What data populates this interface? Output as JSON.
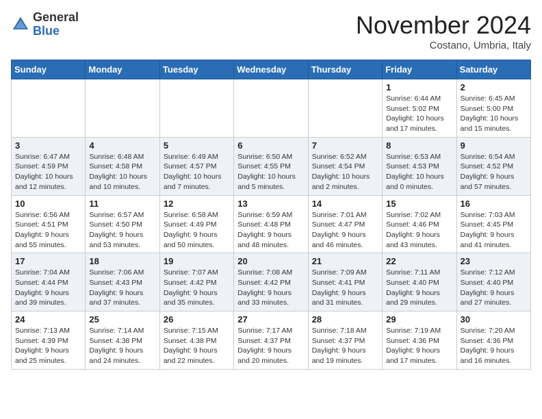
{
  "header": {
    "logo_general": "General",
    "logo_blue": "Blue",
    "month_title": "November 2024",
    "location": "Costano, Umbria, Italy"
  },
  "days_of_week": [
    "Sunday",
    "Monday",
    "Tuesday",
    "Wednesday",
    "Thursday",
    "Friday",
    "Saturday"
  ],
  "weeks": [
    {
      "row_alt": false,
      "days": [
        {
          "date": "",
          "info": ""
        },
        {
          "date": "",
          "info": ""
        },
        {
          "date": "",
          "info": ""
        },
        {
          "date": "",
          "info": ""
        },
        {
          "date": "",
          "info": ""
        },
        {
          "date": "1",
          "info": "Sunrise: 6:44 AM\nSunset: 5:02 PM\nDaylight: 10 hours\nand 17 minutes."
        },
        {
          "date": "2",
          "info": "Sunrise: 6:45 AM\nSunset: 5:00 PM\nDaylight: 10 hours\nand 15 minutes."
        }
      ]
    },
    {
      "row_alt": true,
      "days": [
        {
          "date": "3",
          "info": "Sunrise: 6:47 AM\nSunset: 4:59 PM\nDaylight: 10 hours\nand 12 minutes."
        },
        {
          "date": "4",
          "info": "Sunrise: 6:48 AM\nSunset: 4:58 PM\nDaylight: 10 hours\nand 10 minutes."
        },
        {
          "date": "5",
          "info": "Sunrise: 6:49 AM\nSunset: 4:57 PM\nDaylight: 10 hours\nand 7 minutes."
        },
        {
          "date": "6",
          "info": "Sunrise: 6:50 AM\nSunset: 4:55 PM\nDaylight: 10 hours\nand 5 minutes."
        },
        {
          "date": "7",
          "info": "Sunrise: 6:52 AM\nSunset: 4:54 PM\nDaylight: 10 hours\nand 2 minutes."
        },
        {
          "date": "8",
          "info": "Sunrise: 6:53 AM\nSunset: 4:53 PM\nDaylight: 10 hours\nand 0 minutes."
        },
        {
          "date": "9",
          "info": "Sunrise: 6:54 AM\nSunset: 4:52 PM\nDaylight: 9 hours\nand 57 minutes."
        }
      ]
    },
    {
      "row_alt": false,
      "days": [
        {
          "date": "10",
          "info": "Sunrise: 6:56 AM\nSunset: 4:51 PM\nDaylight: 9 hours\nand 55 minutes."
        },
        {
          "date": "11",
          "info": "Sunrise: 6:57 AM\nSunset: 4:50 PM\nDaylight: 9 hours\nand 53 minutes."
        },
        {
          "date": "12",
          "info": "Sunrise: 6:58 AM\nSunset: 4:49 PM\nDaylight: 9 hours\nand 50 minutes."
        },
        {
          "date": "13",
          "info": "Sunrise: 6:59 AM\nSunset: 4:48 PM\nDaylight: 9 hours\nand 48 minutes."
        },
        {
          "date": "14",
          "info": "Sunrise: 7:01 AM\nSunset: 4:47 PM\nDaylight: 9 hours\nand 46 minutes."
        },
        {
          "date": "15",
          "info": "Sunrise: 7:02 AM\nSunset: 4:46 PM\nDaylight: 9 hours\nand 43 minutes."
        },
        {
          "date": "16",
          "info": "Sunrise: 7:03 AM\nSunset: 4:45 PM\nDaylight: 9 hours\nand 41 minutes."
        }
      ]
    },
    {
      "row_alt": true,
      "days": [
        {
          "date": "17",
          "info": "Sunrise: 7:04 AM\nSunset: 4:44 PM\nDaylight: 9 hours\nand 39 minutes."
        },
        {
          "date": "18",
          "info": "Sunrise: 7:06 AM\nSunset: 4:43 PM\nDaylight: 9 hours\nand 37 minutes."
        },
        {
          "date": "19",
          "info": "Sunrise: 7:07 AM\nSunset: 4:42 PM\nDaylight: 9 hours\nand 35 minutes."
        },
        {
          "date": "20",
          "info": "Sunrise: 7:08 AM\nSunset: 4:42 PM\nDaylight: 9 hours\nand 33 minutes."
        },
        {
          "date": "21",
          "info": "Sunrise: 7:09 AM\nSunset: 4:41 PM\nDaylight: 9 hours\nand 31 minutes."
        },
        {
          "date": "22",
          "info": "Sunrise: 7:11 AM\nSunset: 4:40 PM\nDaylight: 9 hours\nand 29 minutes."
        },
        {
          "date": "23",
          "info": "Sunrise: 7:12 AM\nSunset: 4:40 PM\nDaylight: 9 hours\nand 27 minutes."
        }
      ]
    },
    {
      "row_alt": false,
      "days": [
        {
          "date": "24",
          "info": "Sunrise: 7:13 AM\nSunset: 4:39 PM\nDaylight: 9 hours\nand 25 minutes."
        },
        {
          "date": "25",
          "info": "Sunrise: 7:14 AM\nSunset: 4:38 PM\nDaylight: 9 hours\nand 24 minutes."
        },
        {
          "date": "26",
          "info": "Sunrise: 7:15 AM\nSunset: 4:38 PM\nDaylight: 9 hours\nand 22 minutes."
        },
        {
          "date": "27",
          "info": "Sunrise: 7:17 AM\nSunset: 4:37 PM\nDaylight: 9 hours\nand 20 minutes."
        },
        {
          "date": "28",
          "info": "Sunrise: 7:18 AM\nSunset: 4:37 PM\nDaylight: 9 hours\nand 19 minutes."
        },
        {
          "date": "29",
          "info": "Sunrise: 7:19 AM\nSunset: 4:36 PM\nDaylight: 9 hours\nand 17 minutes."
        },
        {
          "date": "30",
          "info": "Sunrise: 7:20 AM\nSunset: 4:36 PM\nDaylight: 9 hours\nand 16 minutes."
        }
      ]
    }
  ]
}
